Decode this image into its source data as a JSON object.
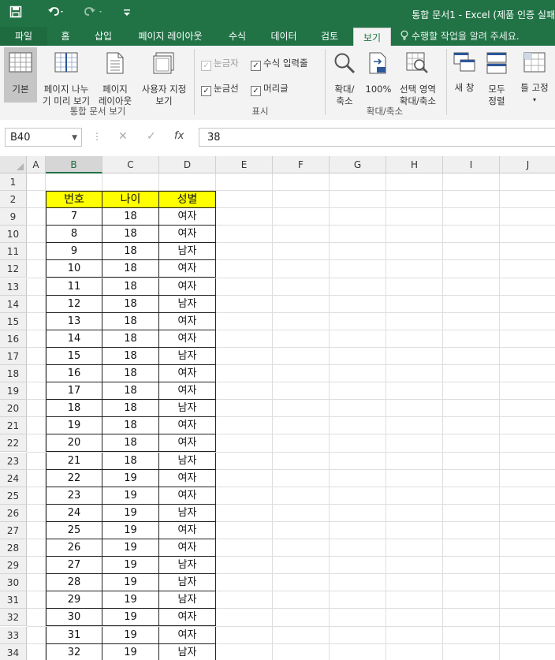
{
  "titlebar": {
    "save_icon": "save-icon",
    "undo_icon": "undo-icon",
    "redo_icon": "redo-icon",
    "customize_icon": "customize-quick-access-icon",
    "title": "통합 문서1 - Excel (제품 인증 실패"
  },
  "tabs": [
    {
      "label": "파일"
    },
    {
      "label": "홈"
    },
    {
      "label": "삽입"
    },
    {
      "label": "페이지 레이아웃"
    },
    {
      "label": "수식"
    },
    {
      "label": "데이터"
    },
    {
      "label": "검토"
    },
    {
      "label": "보기"
    }
  ],
  "tell_me": "수행할 작업을 알려 주세요.",
  "ribbon": {
    "workbook_views": {
      "group_label": "통합 문서 보기",
      "normal": "기본",
      "page_break_1": "페이지 나누",
      "page_break_2": "기 미리 보기",
      "page_layout_1": "페이지",
      "page_layout_2": "레이아웃",
      "custom_1": "사용자 지정",
      "custom_2": "보기"
    },
    "show": {
      "group_label": "표시",
      "ruler": "눈금자",
      "formula_bar": "수식 입력줄",
      "gridlines": "눈금선",
      "headings": "머리글"
    },
    "zoom": {
      "group_label": "확대/축소",
      "zoom_1": "확대/",
      "zoom_2": "축소",
      "zoom100": "100%",
      "zoom_sel_1": "선택 영역",
      "zoom_sel_2": "확대/축소"
    },
    "window": {
      "new_window": "새 창",
      "arrange_1": "모두",
      "arrange_2": "정렬",
      "freeze": "틀 고정"
    }
  },
  "formula_bar": {
    "name_box": "B40",
    "value": "38",
    "fx": "fx"
  },
  "columns": [
    "A",
    "B",
    "C",
    "D",
    "E",
    "F",
    "G",
    "H",
    "I",
    "J"
  ],
  "row_numbers": [
    "1",
    "2",
    "9",
    "10",
    "11",
    "12",
    "13",
    "14",
    "15",
    "16",
    "17",
    "18",
    "19",
    "20",
    "21",
    "22",
    "23",
    "24",
    "25",
    "26",
    "27",
    "28",
    "29",
    "30",
    "31",
    "32",
    "33",
    "34"
  ],
  "table": {
    "headers": [
      "번호",
      "나이",
      "성별"
    ],
    "rows": [
      [
        "7",
        "18",
        "여자"
      ],
      [
        "8",
        "18",
        "여자"
      ],
      [
        "9",
        "18",
        "남자"
      ],
      [
        "10",
        "18",
        "여자"
      ],
      [
        "11",
        "18",
        "여자"
      ],
      [
        "12",
        "18",
        "남자"
      ],
      [
        "13",
        "18",
        "여자"
      ],
      [
        "14",
        "18",
        "여자"
      ],
      [
        "15",
        "18",
        "남자"
      ],
      [
        "16",
        "18",
        "여자"
      ],
      [
        "17",
        "18",
        "여자"
      ],
      [
        "18",
        "18",
        "남자"
      ],
      [
        "19",
        "18",
        "여자"
      ],
      [
        "20",
        "18",
        "여자"
      ],
      [
        "21",
        "18",
        "남자"
      ],
      [
        "22",
        "19",
        "여자"
      ],
      [
        "23",
        "19",
        "여자"
      ],
      [
        "24",
        "19",
        "남자"
      ],
      [
        "25",
        "19",
        "여자"
      ],
      [
        "26",
        "19",
        "여자"
      ],
      [
        "27",
        "19",
        "남자"
      ],
      [
        "28",
        "19",
        "남자"
      ],
      [
        "29",
        "19",
        "남자"
      ],
      [
        "30",
        "19",
        "여자"
      ],
      [
        "31",
        "19",
        "여자"
      ],
      [
        "32",
        "19",
        "남자"
      ]
    ]
  }
}
